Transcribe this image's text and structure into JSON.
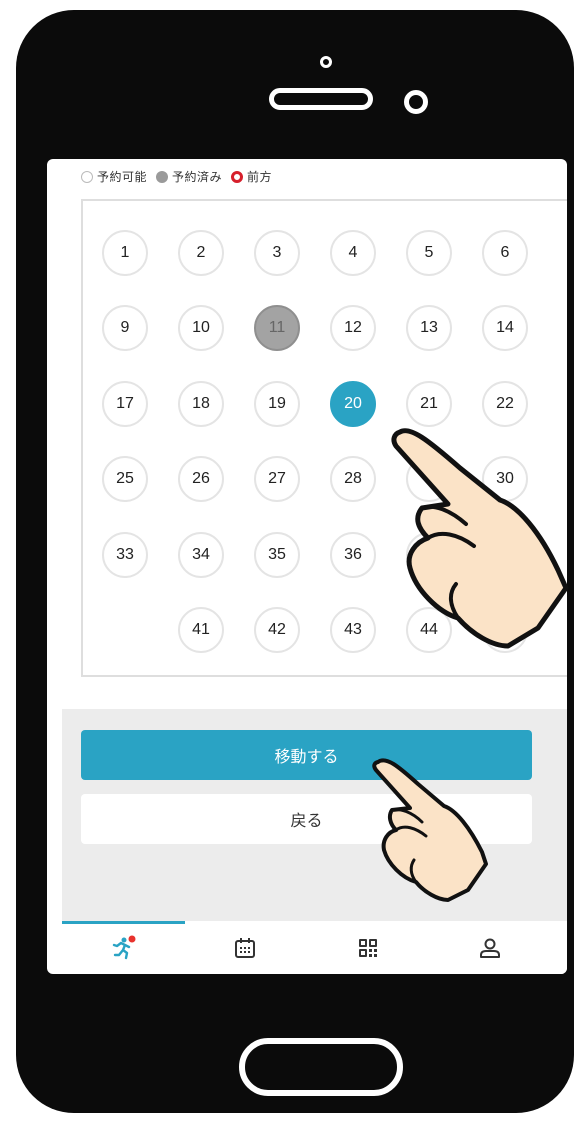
{
  "legend": {
    "available": "予約可能",
    "booked": "予約済み",
    "front": "前方"
  },
  "seats": {
    "s1": "1",
    "s2": "2",
    "s3": "3",
    "s4": "4",
    "s5": "5",
    "s6": "6",
    "s9": "9",
    "s10": "10",
    "s11": "11",
    "s12": "12",
    "s13": "13",
    "s14": "14",
    "s17": "17",
    "s18": "18",
    "s19": "19",
    "s20": "20",
    "s21": "21",
    "s22": "22",
    "s25": "25",
    "s26": "26",
    "s27": "27",
    "s28": "28",
    "s30": "30",
    "s33": "33",
    "s34": "34",
    "s35": "35",
    "s36": "36",
    "s41": "41",
    "s42": "42",
    "s43": "43",
    "s44": "44"
  },
  "seat_states": {
    "booked": [
      "11"
    ],
    "selected": "20"
  },
  "actions": {
    "move_label": "移動する",
    "back_label": "戻る"
  },
  "tabs": [
    {
      "icon": "running-person-icon",
      "active": true,
      "has_badge": true
    },
    {
      "icon": "calendar-icon",
      "active": false
    },
    {
      "icon": "qr-code-icon",
      "active": false
    },
    {
      "icon": "user-icon",
      "active": false
    }
  ],
  "colors": {
    "accent": "#2aa3c4",
    "booked": "#a3a3a3",
    "front_marker": "#d61f2b",
    "badge": "#e8322d"
  }
}
